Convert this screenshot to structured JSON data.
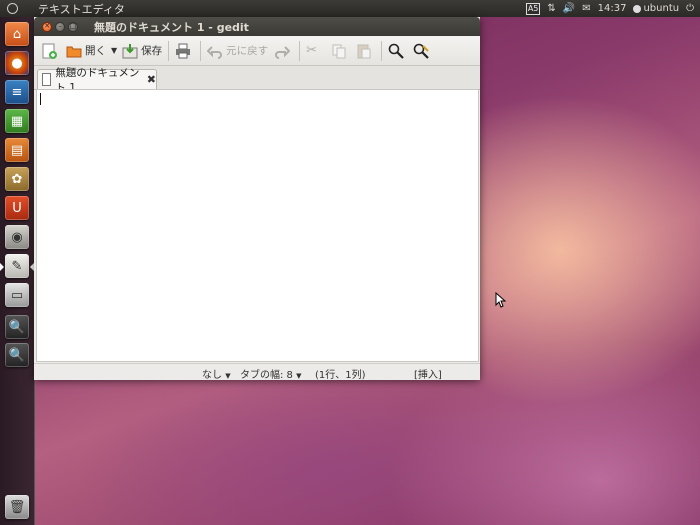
{
  "top_panel": {
    "app_name": "テキストエディタ",
    "input_method": "A5",
    "clock": "14:37",
    "user": "ubuntu"
  },
  "launcher": {
    "items": [
      "home-folder",
      "firefox",
      "writer",
      "calc",
      "impress",
      "software-center",
      "ubuntu-one",
      "screenshot",
      "gedit",
      "workspace-switcher",
      "magnifier",
      "magnifier-2"
    ]
  },
  "window": {
    "title": "無題のドキュメント 1 - gedit",
    "toolbar": {
      "open_label": "開く",
      "save_label": "保存",
      "undo_label": "元に戻す"
    },
    "tab": {
      "label": "無題のドキュメント 1"
    },
    "status": {
      "highlight_mode": "なし",
      "tab_width": "タブの幅: 8",
      "position": "(1行、1列)",
      "insert_mode": "[挿入]"
    }
  },
  "colors": {
    "close_button": "#e0551e",
    "panel": "#3c3b37",
    "wallpaper": "#8a3a6a"
  }
}
